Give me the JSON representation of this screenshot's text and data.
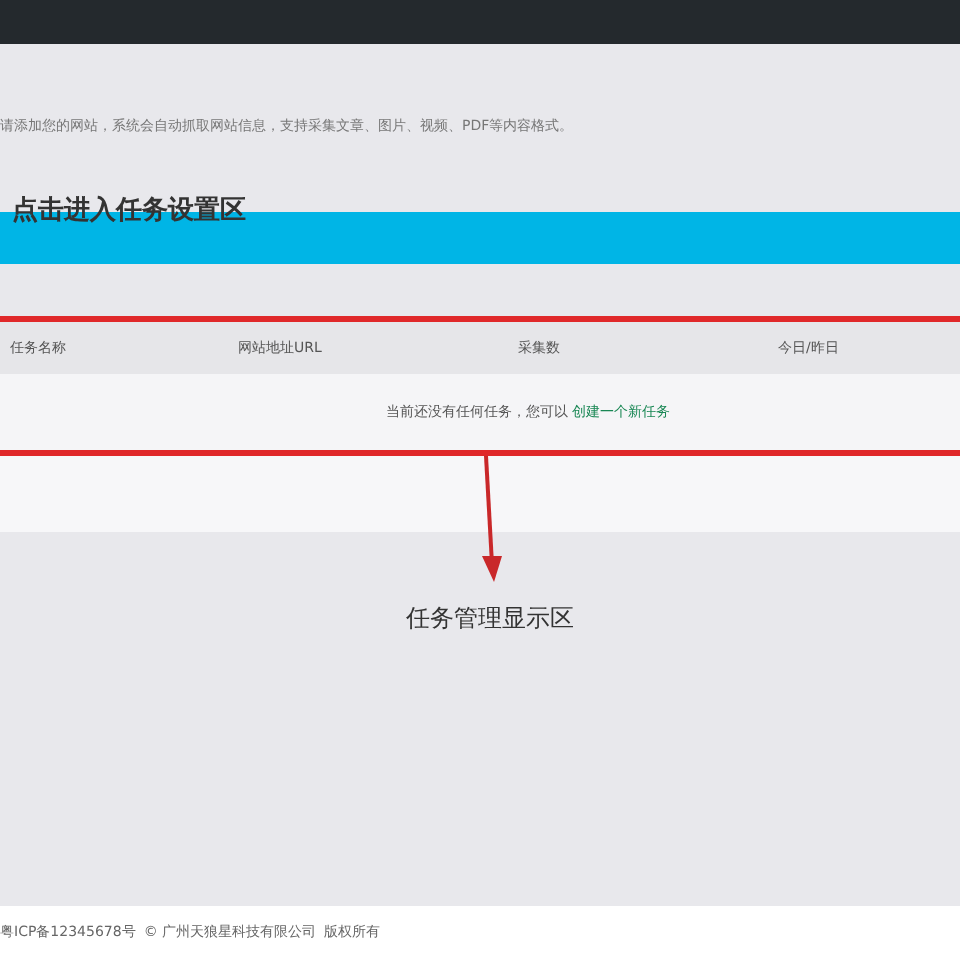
{
  "hint": "请添加您的网站，系统会自动抓取网站信息，支持采集文章、图片、视频、PDF等内容格式。",
  "banner": {
    "annotation": "点击进入任务设置区"
  },
  "table": {
    "columns": [
      "任务名称",
      "网站地址URL",
      "采集数",
      "今日/昨日"
    ],
    "empty": {
      "text": "当前还没有任何任务，您可以",
      "link": "创建一个新任务"
    }
  },
  "annotation": "任务管理显示区",
  "footer": {
    "icp": "粤ICP备12345678号",
    "company": "© 广州天狼星科技有限公司",
    "rights": "版权所有"
  }
}
